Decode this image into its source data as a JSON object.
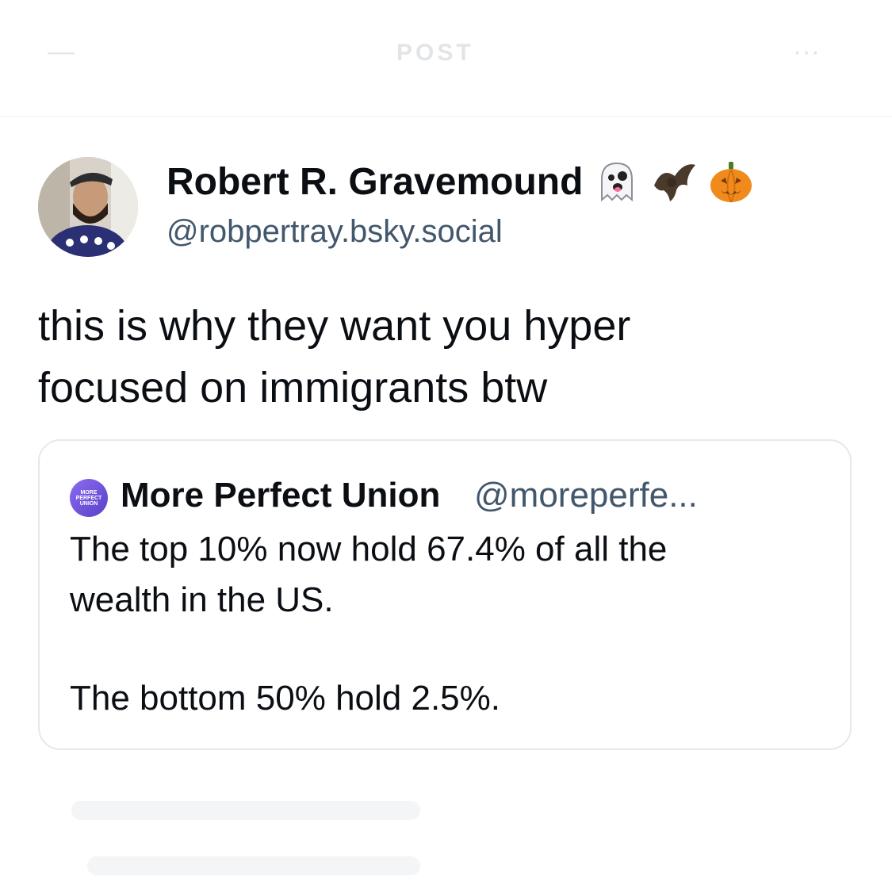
{
  "header": {
    "title": "POST",
    "back_icon": "back-arrow-icon",
    "more_icon": "more-icon"
  },
  "post": {
    "author_name": "Robert R. Gravemound",
    "author_emojis": [
      "ghost-icon",
      "bat-icon",
      "pumpkin-icon"
    ],
    "author_handle": "@robpertray.bsky.social",
    "text_line1": "this is why they want you hyper",
    "text_line2": "focused on immigrants btw"
  },
  "quote": {
    "avatar_text": [
      "MORE",
      "PERFECT",
      "UNION"
    ],
    "author_name": "More Perfect Union",
    "author_handle": "@moreperfe...",
    "line1": "The top 10% now hold 67.4% of all the",
    "line2": "wealth in the US.",
    "line3": "The bottom 50% hold 2.5%."
  },
  "colors": {
    "text": "#0b0f14",
    "handle": "#42576c",
    "border": "#e6e8eb"
  }
}
